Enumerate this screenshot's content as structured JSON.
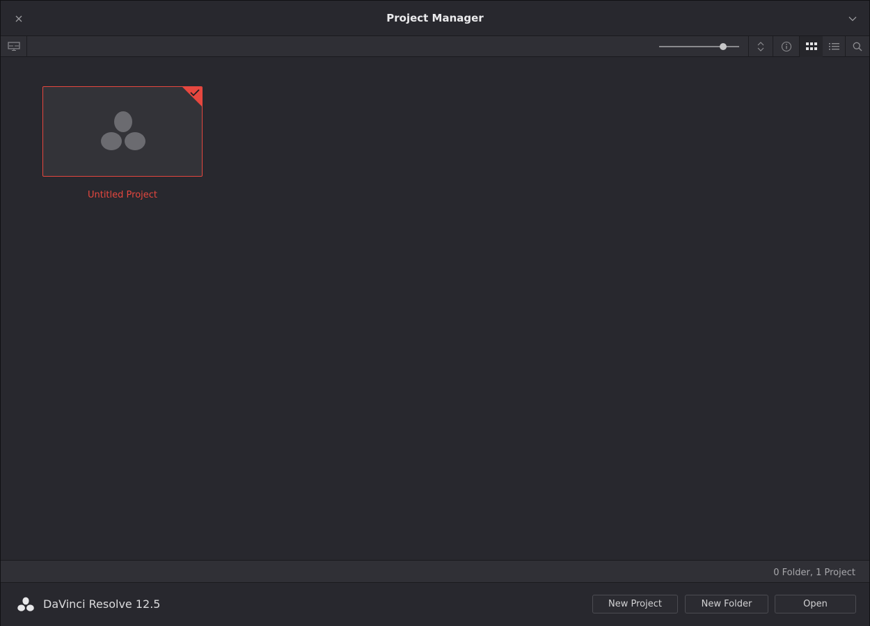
{
  "window": {
    "title": "Project Manager"
  },
  "toolbar": {
    "icons": [
      "monitor-icon",
      "slider",
      "sort-icon",
      "info-icon",
      "grid-view-icon",
      "list-view-icon",
      "search-icon"
    ],
    "thumbnail_size": 0.8
  },
  "projects": [
    {
      "name": "Untitled Project",
      "selected": true
    }
  ],
  "status": {
    "count_text": "0 Folder, 1 Project"
  },
  "footer": {
    "app_name": "DaVinci Resolve 12.5",
    "buttons": {
      "new_project": "New Project",
      "new_folder": "New Folder",
      "open": "Open"
    }
  },
  "colors": {
    "accent": "#e6473f",
    "background": "#28282e",
    "toolbar": "#2f2f35"
  }
}
